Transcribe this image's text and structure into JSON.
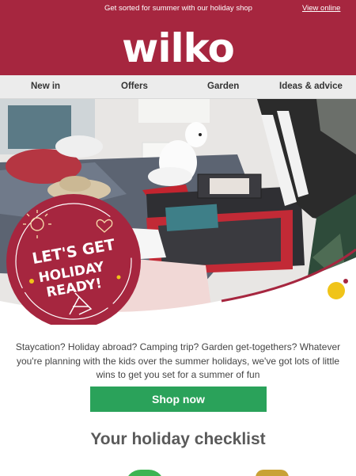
{
  "header": {
    "promo_text": "Get sorted for summer with our holiday shop",
    "view_online": "View online",
    "logo": "wilko"
  },
  "nav": {
    "items": [
      {
        "label": "New in"
      },
      {
        "label": "Offers"
      },
      {
        "label": "Garden"
      },
      {
        "label": "Ideas & advice"
      }
    ]
  },
  "hero": {
    "badge_line1": "LET'S GET",
    "badge_line2": "HOLIDAY READY!"
  },
  "intro": {
    "text": "Staycation? Holiday abroad? Camping trip? Garden get-togethers? Whatever you're planning with the kids over the summer holidays, we've got lots of little wins to get you set for a summer of fun"
  },
  "cta": {
    "shop_now": "Shop now"
  },
  "checklist": {
    "title": "Your holiday checklist"
  },
  "colors": {
    "brand": "#a6263f",
    "cta": "#2aa25a",
    "nav_bg": "#ececec"
  }
}
